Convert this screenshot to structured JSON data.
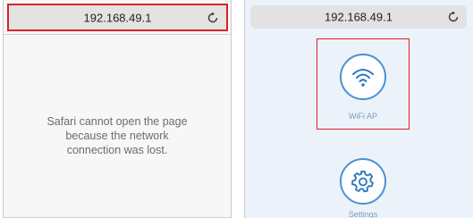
{
  "left_screen": {
    "url": "192.168.49.1",
    "reload_icon": "reload-icon",
    "error_lines": [
      "Safari cannot open the page",
      "because the network",
      "connection was lost."
    ]
  },
  "right_screen": {
    "url": "192.168.49.1",
    "reload_icon": "reload-icon",
    "apps": [
      {
        "label": "WiFi AP",
        "icon": "wifi-icon",
        "highlighted": true
      },
      {
        "label": "Settings",
        "icon": "gear-icon",
        "highlighted": false
      }
    ]
  },
  "colors": {
    "highlight": "#d8212a",
    "accent": "#4c90d3"
  }
}
